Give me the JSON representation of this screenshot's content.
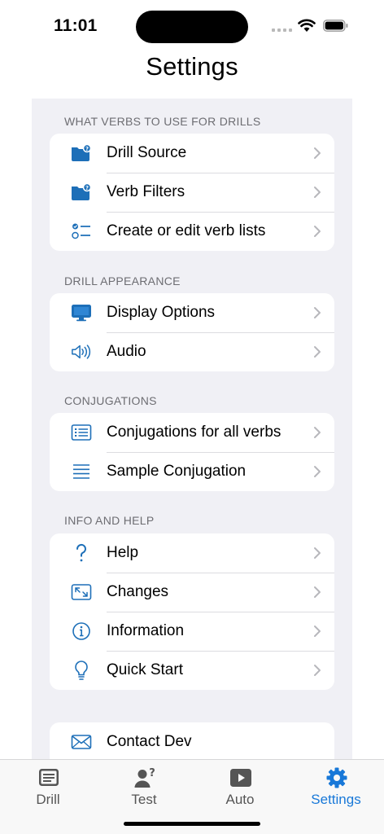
{
  "status": {
    "time": "11:01"
  },
  "title": "Settings",
  "sections": [
    {
      "header": "WHAT VERBS TO USE FOR DRILLS",
      "items": [
        {
          "label": "Drill Source",
          "icon": "folder-question-icon"
        },
        {
          "label": "Verb Filters",
          "icon": "folder-question-icon"
        },
        {
          "label": "Create or edit verb lists",
          "icon": "checklist-icon"
        }
      ]
    },
    {
      "header": "DRILL APPEARANCE",
      "items": [
        {
          "label": "Display Options",
          "icon": "display-icon"
        },
        {
          "label": "Audio",
          "icon": "speaker-icon"
        }
      ]
    },
    {
      "header": "CONJUGATIONS",
      "items": [
        {
          "label": "Conjugations for all verbs",
          "icon": "list-box-icon"
        },
        {
          "label": "Sample Conjugation",
          "icon": "lines-icon"
        }
      ]
    },
    {
      "header": "INFO AND HELP",
      "items": [
        {
          "label": "Help",
          "icon": "question-icon"
        },
        {
          "label": "Changes",
          "icon": "arrows-in-box-icon"
        },
        {
          "label": "Information",
          "icon": "info-icon"
        },
        {
          "label": "Quick Start",
          "icon": "lightbulb-icon"
        }
      ]
    },
    {
      "header": "",
      "items": [
        {
          "label": "Contact Dev",
          "icon": "envelope-icon"
        }
      ]
    }
  ],
  "tabs": [
    {
      "label": "Drill",
      "icon": "list-box-icon",
      "active": false
    },
    {
      "label": "Test",
      "icon": "person-question-icon",
      "active": false
    },
    {
      "label": "Auto",
      "icon": "play-icon",
      "active": false
    },
    {
      "label": "Settings",
      "icon": "gear-icon",
      "active": true
    }
  ],
  "colors": {
    "accent": "#1878d8",
    "icon_blue": "#1d6fb8",
    "grouped_bg": "#f0f0f5"
  }
}
